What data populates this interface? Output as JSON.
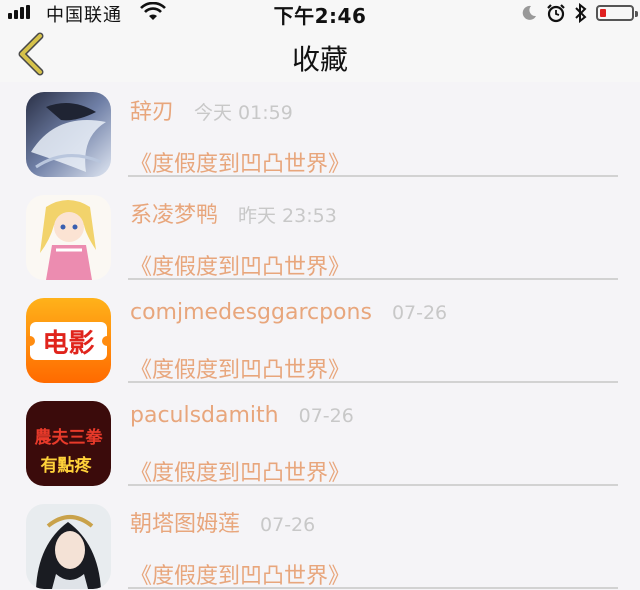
{
  "status_bar": {
    "carrier": "中国联通",
    "time": "下午2:46",
    "battery_level_percent": 18,
    "icons": [
      "signal-icon",
      "wifi-icon",
      "moon-icon",
      "alarm-icon",
      "bluetooth-icon",
      "battery-icon"
    ]
  },
  "nav": {
    "back_icon": "chevron-left-icon",
    "title": "收藏"
  },
  "colors": {
    "accent": "#e8a67c",
    "back_arrow": "#d6c24a",
    "timestamp": "#c8c8c8",
    "battery_low": "#e02020"
  },
  "favorites": [
    {
      "username": "辞刃",
      "time": "今天 01:59",
      "title": "《度假度到凹凸世界》",
      "avatar": "anime-avatar-icon"
    },
    {
      "username": "系凌梦鸭",
      "time": "昨天 23:53",
      "title": "《度假度到凹凸世界》",
      "avatar": "anime-girl-avatar-icon"
    },
    {
      "username": "comjmedesggarcpons",
      "time": "07-26",
      "title": "《度假度到凹凸世界》",
      "avatar": "movie-app-icon",
      "avatar_text": "电影"
    },
    {
      "username": "paculsdamith",
      "time": "07-26",
      "title": "《度假度到凹凸世界》",
      "avatar": "text-avatar-icon",
      "avatar_text_line1": "農夫三拳",
      "avatar_text_line2": "有點疼"
    },
    {
      "username": "朝塔图姆莲",
      "time": "07-26",
      "title": "《度假度到凹凸世界》",
      "avatar": "portrait-avatar-icon"
    }
  ]
}
